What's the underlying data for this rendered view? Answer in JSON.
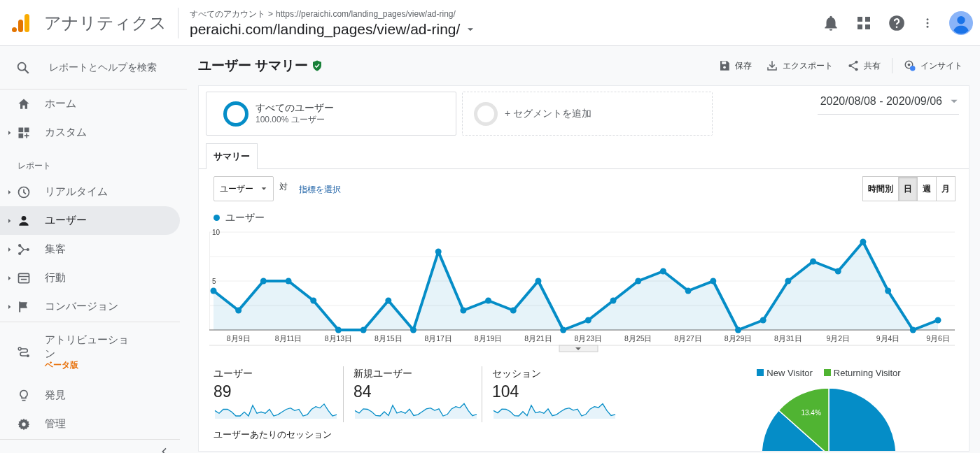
{
  "header": {
    "app_name": "アナリティクス",
    "breadcrumb_root": "すべてのアカウント",
    "breadcrumb_sep": ">",
    "breadcrumb_url": "https://peraichi.com/landing_pages/view/ad-ring/",
    "property": "peraichi.com/landing_pages/view/ad-ring/"
  },
  "sidebar": {
    "search_placeholder": "レポートとヘルプを検索",
    "items": [
      {
        "kind": "nav",
        "label": "ホーム",
        "expandable": false,
        "selected": false
      },
      {
        "kind": "nav",
        "label": "カスタム",
        "expandable": true,
        "selected": false
      },
      {
        "kind": "section",
        "label": "レポート"
      },
      {
        "kind": "nav",
        "label": "リアルタイム",
        "expandable": true,
        "selected": false
      },
      {
        "kind": "nav",
        "label": "ユーザー",
        "expandable": true,
        "selected": true
      },
      {
        "kind": "nav",
        "label": "集客",
        "expandable": true,
        "selected": false
      },
      {
        "kind": "nav",
        "label": "行動",
        "expandable": true,
        "selected": false
      },
      {
        "kind": "nav",
        "label": "コンバージョン",
        "expandable": true,
        "selected": false
      },
      {
        "kind": "divider"
      },
      {
        "kind": "nav",
        "label": "アトリビューション",
        "badge": "ベータ版",
        "expandable": false,
        "selected": false
      },
      {
        "kind": "nav",
        "label": "発見",
        "expandable": false,
        "selected": false
      },
      {
        "kind": "nav",
        "label": "管理",
        "expandable": false,
        "selected": false
      },
      {
        "kind": "divider"
      }
    ]
  },
  "page": {
    "title": "ユーザー サマリー",
    "verified": true,
    "actions": [
      "保存",
      "エクスポート",
      "共有",
      "インサイト"
    ]
  },
  "segments": [
    {
      "kind": "active",
      "label": "すべてのユーザー",
      "sub": "100.00% ユーザー"
    },
    {
      "kind": "add",
      "label": "+ セグメントを追加"
    }
  ],
  "date_range": "2020/08/08 - 2020/09/06",
  "tabs": [
    {
      "label": "サマリー",
      "selected": true
    }
  ],
  "metric_select": "ユーザー",
  "versus": "対",
  "metric_link": "指標を選択",
  "granularity": [
    {
      "label": "時間別",
      "selected": false
    },
    {
      "label": "日",
      "selected": true
    },
    {
      "label": "週",
      "selected": false
    },
    {
      "label": "月",
      "selected": false
    }
  ],
  "chart": {
    "chart_data": {
      "type": "area",
      "categories": [
        null,
        "8月9日",
        null,
        "8月11日",
        null,
        "8月13日",
        null,
        "8月15日",
        null,
        "8月17日",
        null,
        "8月19日",
        null,
        "8月21日",
        null,
        "8月23日",
        null,
        "8月25日",
        null,
        "8月27日",
        null,
        "8月29日",
        null,
        "8月31日",
        null,
        "9月2日",
        null,
        "9月4日",
        null,
        "9月6日"
      ],
      "yticks": [
        5,
        10
      ],
      "ylim": [
        0,
        10
      ],
      "series": [
        {
          "name": "ユーザー",
          "color": "#058dc7",
          "values": [
            4,
            2,
            5,
            5,
            3,
            0,
            0,
            3,
            0,
            8,
            2,
            3,
            2,
            5,
            0,
            1,
            3,
            5,
            6,
            4,
            5,
            0,
            1,
            5,
            7,
            6,
            9,
            4,
            0,
            1
          ]
        }
      ]
    }
  },
  "scorecards": [
    {
      "label": "ユーザー",
      "value": "89"
    },
    {
      "label": "新規ユーザー",
      "value": "84"
    },
    {
      "label": "セッション",
      "value": "104"
    }
  ],
  "next_metric_label": "ユーザーあたりのセッション",
  "pie": {
    "legend": [
      {
        "color": "#058dc7"
      },
      {
        "color": "#50b432"
      }
    ],
    "chart_data": {
      "type": "pie",
      "categories": [
        "New Visitor",
        "Returning Visitor"
      ],
      "values": [
        86.6,
        13.4
      ],
      "value_labels": [
        null,
        "13.4%"
      ]
    }
  }
}
